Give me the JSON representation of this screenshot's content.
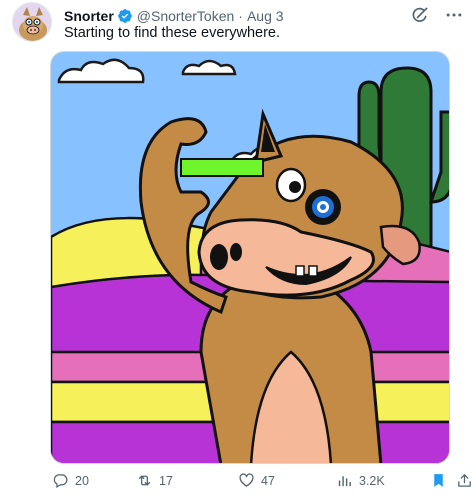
{
  "tweet": {
    "display_name": "Snorter",
    "handle": "@SnorterToken",
    "separator": "·",
    "time": "Aug 3",
    "text": "Starting to find these everywhere."
  },
  "icons": {
    "verified": "verified-badge-icon",
    "grok": "grok-icon",
    "more": "more-options-icon"
  },
  "actions": {
    "replies": "20",
    "retweets": "17",
    "likes": "47",
    "views": "3.2K"
  },
  "colors": {
    "verified": "#1d9bf0",
    "bookmark_active": "#1d9bf0",
    "secondary_text": "#536471",
    "sky": "#88c1ff",
    "desert_purple": "#b833d6",
    "desert_yellow": "#f6f05a"
  }
}
